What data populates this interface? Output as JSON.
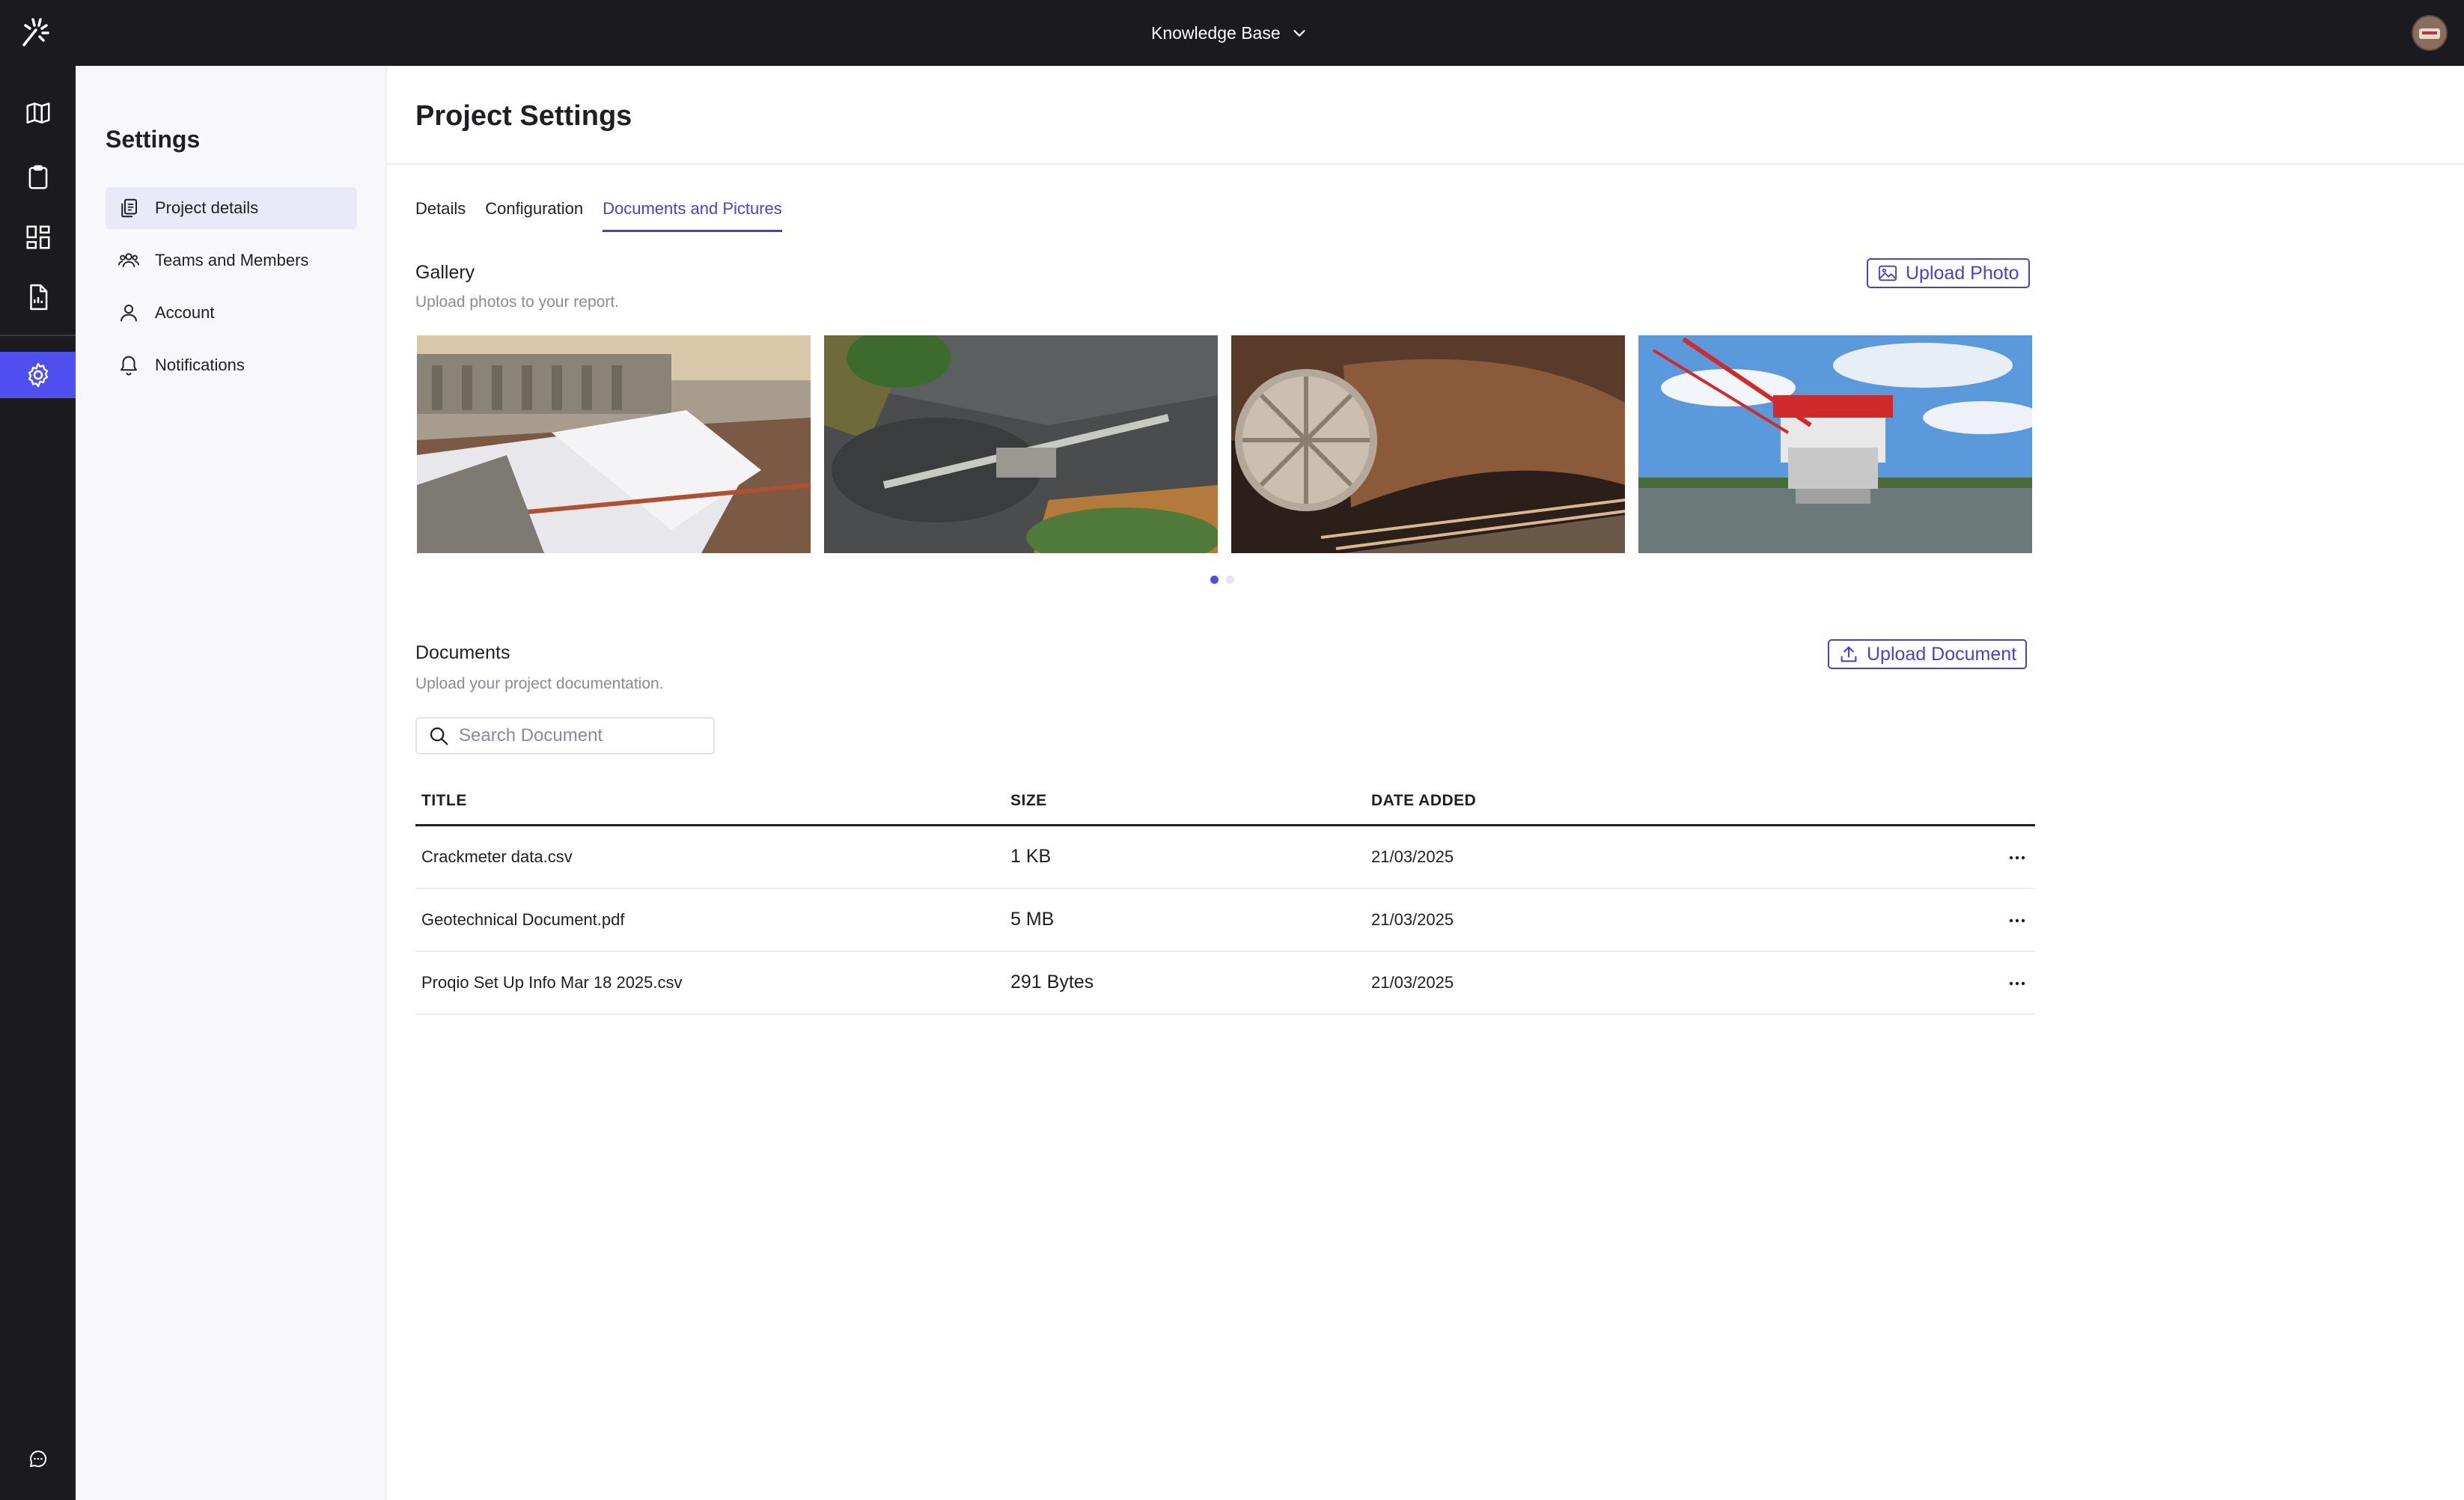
{
  "topbar": {
    "workspace_label": "Knowledge Base"
  },
  "rail": {
    "items": [
      {
        "icon": "map-icon"
      },
      {
        "icon": "clipboard-icon"
      },
      {
        "icon": "dashboard-icon"
      },
      {
        "icon": "report-icon"
      },
      {
        "icon": "gear-icon",
        "active": true
      },
      {
        "icon": "chat-icon"
      }
    ]
  },
  "sidebar": {
    "title": "Settings",
    "items": [
      {
        "label": "Project details",
        "icon": "copy-document-icon",
        "active": true
      },
      {
        "label": "Teams and Members",
        "icon": "team-icon"
      },
      {
        "label": "Account",
        "icon": "user-icon"
      },
      {
        "label": "Notifications",
        "icon": "bell-icon"
      }
    ]
  },
  "page": {
    "title": "Project Settings"
  },
  "tabs": [
    {
      "label": "Details"
    },
    {
      "label": "Configuration"
    },
    {
      "label": "Documents and Pictures",
      "active": true
    }
  ],
  "gallery": {
    "title": "Gallery",
    "subtitle": "Upload photos to your report.",
    "upload_label": "Upload Photo",
    "pages": 2,
    "current_page": 1
  },
  "documents": {
    "title": "Documents",
    "subtitle": "Upload your project documentation.",
    "upload_label": "Upload Document",
    "search_placeholder": "Search Document",
    "columns": {
      "title": "TITLE",
      "size": "SIZE",
      "date": "DATE ADDED"
    },
    "rows": [
      {
        "title": "Crackmeter data.csv",
        "size": "1 KB",
        "date": "21/03/2025"
      },
      {
        "title": "Geotechnical Document.pdf",
        "size": "5 MB",
        "date": "21/03/2025"
      },
      {
        "title": "Proqio Set Up Info Mar 18 2025.csv",
        "size": "291 Bytes",
        "date": "21/03/2025"
      }
    ]
  },
  "colors": {
    "accent": "#4a3fd0",
    "rail_active": "#4f4ff0",
    "dark": "#1b1b1f"
  }
}
